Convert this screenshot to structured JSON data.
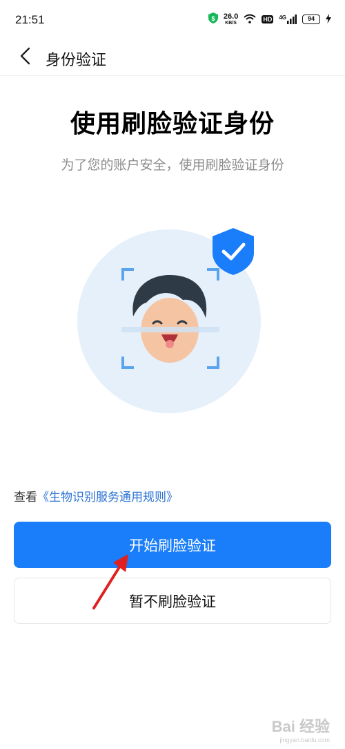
{
  "status_bar": {
    "time": "21:51",
    "net_speed_value": "26.0",
    "net_speed_unit": "KB/S",
    "hd_badge": "HD",
    "network_label": "4G",
    "battery_level": "94",
    "icons": [
      "shield-icon",
      "wifi-icon",
      "signal-icon",
      "battery-icon",
      "charging-icon"
    ]
  },
  "nav": {
    "title": "身份验证",
    "back_icon": "chevron-left-icon"
  },
  "main": {
    "heading": "使用刷脸验证身份",
    "subheading": "为了您的账户安全，使用刷脸验证身份"
  },
  "terms": {
    "prefix": "查看",
    "link_text": "《生物识别服务通用规则》"
  },
  "buttons": {
    "primary_label": "开始刷脸验证",
    "secondary_label": "暂不刷脸验证"
  },
  "watermark": {
    "main": "Bai 经验",
    "sub": "jingyan.baidu.com"
  },
  "colors": {
    "accent": "#1a7dfa",
    "link": "#2b72d6",
    "subtext": "#8c8c8c",
    "illustration_bg": "#e6f0fb",
    "shield": "#1a7dfa",
    "arrow": "#e02020"
  }
}
